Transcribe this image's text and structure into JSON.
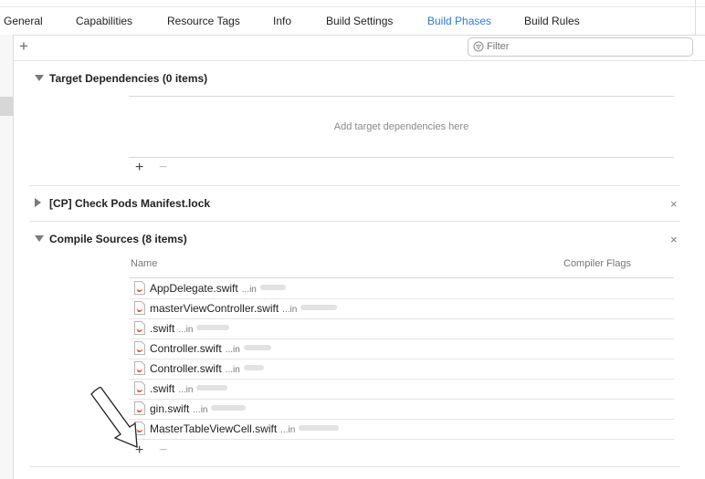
{
  "tabs": [
    {
      "label": "General",
      "active": false
    },
    {
      "label": "Capabilities",
      "active": false
    },
    {
      "label": "Resource Tags",
      "active": false
    },
    {
      "label": "Info",
      "active": false
    },
    {
      "label": "Build Settings",
      "active": false
    },
    {
      "label": "Build Phases",
      "active": true
    },
    {
      "label": "Build Rules",
      "active": false
    }
  ],
  "toolbar": {
    "add_label": "+",
    "filter_placeholder": "Filter"
  },
  "target_dependencies": {
    "title": "Target Dependencies (0 items)",
    "placeholder": "Add target dependencies here",
    "add_label": "+",
    "remove_label": "−"
  },
  "check_pods": {
    "title": "[CP] Check Pods Manifest.lock",
    "delete_label": "×"
  },
  "compile_sources": {
    "title": "Compile Sources (8 items)",
    "delete_label": "×",
    "col_name": "Name",
    "col_flags": "Compiler Flags",
    "add_label": "+",
    "remove_label": "−",
    "files": [
      {
        "name": "AppDelegate.swift",
        "path": "...in"
      },
      {
        "name": "masterViewController.swift",
        "path": "...in"
      },
      {
        "name": ".swift",
        "path": "...in"
      },
      {
        "name": "Controller.swift",
        "path": "...in"
      },
      {
        "name": "Controller.swift",
        "path": "...in"
      },
      {
        "name": ".swift",
        "path": "...in"
      },
      {
        "name": "gin.swift",
        "path": "...in"
      },
      {
        "name": "MasterTableViewCell.swift",
        "path": "...in"
      }
    ]
  },
  "colors": {
    "accent": "#2f7be0",
    "swift_icon": "#e8553e"
  }
}
